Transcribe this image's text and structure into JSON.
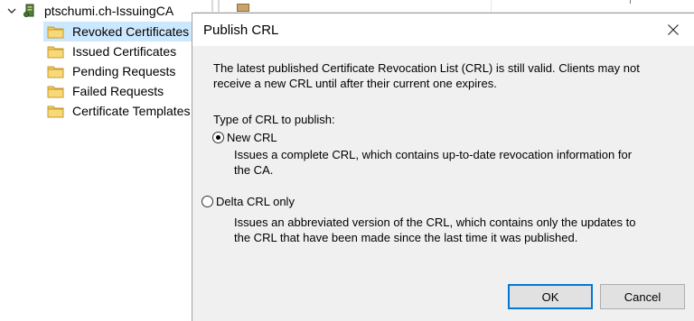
{
  "tree": {
    "root_label": "ptschumi.ch-IssuingCA",
    "items": [
      {
        "label": "Revoked Certificates",
        "selected": true
      },
      {
        "label": "Issued Certificates",
        "selected": false
      },
      {
        "label": "Pending Requests",
        "selected": false
      },
      {
        "label": "Failed Requests",
        "selected": false
      },
      {
        "label": "Certificate Templates",
        "selected": false
      }
    ]
  },
  "dialog": {
    "title": "Publish CRL",
    "message_line1": "The latest published Certificate Revocation List (CRL) is still valid. Clients may not",
    "message_line2": "receive a new CRL until after their current one expires.",
    "type_label": "Type of CRL to publish:",
    "options": [
      {
        "label": "New CRL",
        "checked": true,
        "desc_line1": "Issues a complete CRL, which contains up-to-date revocation information for",
        "desc_line2": "the CA."
      },
      {
        "label": "Delta CRL only",
        "checked": false,
        "desc_line1": "Issues an abbreviated version of the CRL, which contains only the updates to",
        "desc_line2": "the CRL that have been made since the last time it was published."
      }
    ],
    "ok_label": "OK",
    "cancel_label": "Cancel"
  },
  "colors": {
    "selection": "#cce8ff",
    "dialog_bg": "#f0f0f0",
    "default_button_border": "#0078d7",
    "folder": "#f2c95f"
  },
  "icons": {
    "expand": "chevron-down-icon",
    "root": "certificate-authority-icon",
    "folder": "folder-icon",
    "close": "close-icon"
  }
}
